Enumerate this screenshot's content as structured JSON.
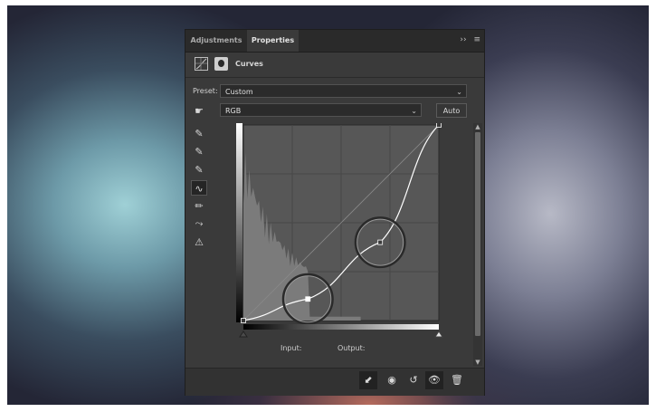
{
  "tabs": {
    "adjustments": "Adjustments",
    "properties": "Properties"
  },
  "panel_menu": {
    "collapse": "››",
    "menu": "≡"
  },
  "header": {
    "title": "Curves",
    "layer_type_icon": "curves-adjustment-icon",
    "mask_icon": "layer-mask-icon"
  },
  "preset": {
    "label": "Preset:",
    "value": "Custom"
  },
  "channel": {
    "value": "RGB"
  },
  "auto_button": "Auto",
  "tools": [
    "on-image-adjustment-icon",
    "black-point-eyedropper-icon",
    "gray-point-eyedropper-icon",
    "white-point-eyedropper-icon",
    "curve-points-icon",
    "pencil-icon",
    "smooth-icon",
    "clipping-warning-icon"
  ],
  "io": {
    "input_label": "Input:",
    "output_label": "Output:"
  },
  "bottom_icons": [
    "clip-to-layer-icon",
    "view-previous-icon",
    "reset-icon",
    "visibility-eye-icon",
    "trash-icon"
  ],
  "curve": {
    "points": [
      [
        0,
        0
      ],
      [
        33,
        11
      ],
      [
        70,
        40
      ],
      [
        100,
        100
      ]
    ],
    "highlighted_points": [
      [
        33,
        11
      ],
      [
        70,
        40
      ]
    ],
    "selected_point": [
      33,
      11
    ]
  },
  "colors": {
    "panel": "#3a3a3a",
    "graph_bg": "#575757",
    "histogram": "#7b7b7b",
    "curve": "#ffffff"
  }
}
